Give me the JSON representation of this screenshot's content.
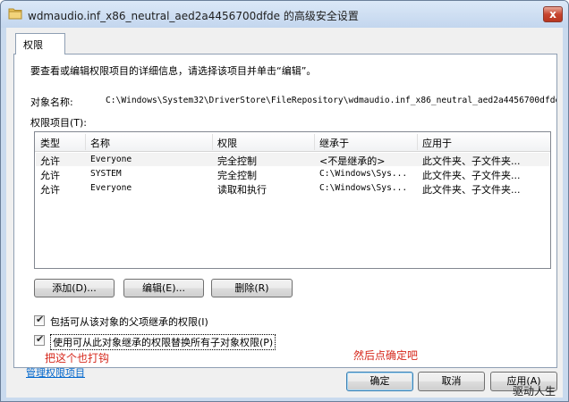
{
  "window": {
    "title": "wdmaudio.inf_x86_neutral_aed2a4456700dfde 的高级安全设置",
    "close_label": "x"
  },
  "tab": {
    "label": "权限"
  },
  "panel": {
    "instructions": "要查看或编辑权限项目的详细信息，请选择该项目并单击“编辑”。",
    "object_name_label": "对象名称:",
    "object_path": "C:\\Windows\\System32\\DriverStore\\FileRepository\\wdmaudio.inf_x86_neutral_aed2a4456700dfde",
    "permission_entries_label": "权限项目(T):"
  },
  "list": {
    "headers": [
      "类型",
      "名称",
      "权限",
      "继承于",
      "应用于"
    ],
    "rows": [
      {
        "type": "允许",
        "name": "Everyone",
        "permission": "完全控制",
        "inherited_from": "<不是继承的>",
        "apply_to": "此文件夹、子文件夹..."
      },
      {
        "type": "允许",
        "name": "SYSTEM",
        "permission": "完全控制",
        "inherited_from": "C:\\Windows\\Sys...",
        "apply_to": "此文件夹、子文件夹..."
      },
      {
        "type": "允许",
        "name": "Everyone",
        "permission": "读取和执行",
        "inherited_from": "C:\\Windows\\Sys...",
        "apply_to": "此文件夹、子文件夹..."
      }
    ]
  },
  "buttons": {
    "add": "添加(D)...",
    "edit": "编辑(E)...",
    "delete": "删除(R)",
    "ok": "确定",
    "cancel": "取消",
    "apply": "应用(A)"
  },
  "checkboxes": {
    "include_inheritable": {
      "label": "包括可从该对象的父项继承的权限(I)",
      "checked": true
    },
    "replace_child": {
      "label": "使用可从此对象继承的权限替换所有子对象权限(P)",
      "checked": true
    }
  },
  "annotations": {
    "check_this_too": "把这个也打钩",
    "then_click_ok": "然后点确定吧"
  },
  "link": {
    "manage": "管理权限项目"
  },
  "watermark": "驱动人生",
  "colors": {
    "annotation": "#d62a1e",
    "link": "#0066cc",
    "frame": "#c9daee"
  }
}
